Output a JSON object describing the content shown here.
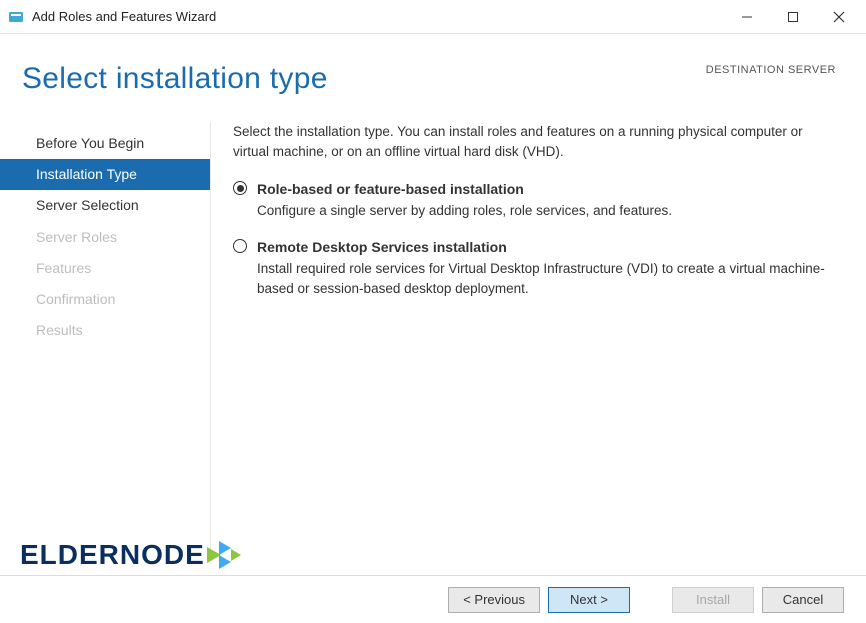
{
  "window": {
    "title": "Add Roles and Features Wizard"
  },
  "header": {
    "page_title": "Select installation type",
    "destination_label": "DESTINATION SERVER"
  },
  "sidebar": {
    "items": [
      {
        "label": "Before You Begin",
        "state": "completed"
      },
      {
        "label": "Installation Type",
        "state": "active"
      },
      {
        "label": "Server Selection",
        "state": "completed"
      },
      {
        "label": "Server Roles",
        "state": "disabled"
      },
      {
        "label": "Features",
        "state": "disabled"
      },
      {
        "label": "Confirmation",
        "state": "disabled"
      },
      {
        "label": "Results",
        "state": "disabled"
      }
    ]
  },
  "content": {
    "intro": "Select the installation type. You can install roles and features on a running physical computer or virtual machine, or on an offline virtual hard disk (VHD).",
    "options": [
      {
        "title": "Role-based or feature-based installation",
        "desc": "Configure a single server by adding roles, role services, and features.",
        "selected": true
      },
      {
        "title": "Remote Desktop Services installation",
        "desc": "Install required role services for Virtual Desktop Infrastructure (VDI) to create a virtual machine-based or session-based desktop deployment.",
        "selected": false
      }
    ]
  },
  "footer": {
    "previous": "< Previous",
    "next": "Next >",
    "install": "Install",
    "cancel": "Cancel"
  },
  "watermark": {
    "text": "ELDERNODE"
  }
}
